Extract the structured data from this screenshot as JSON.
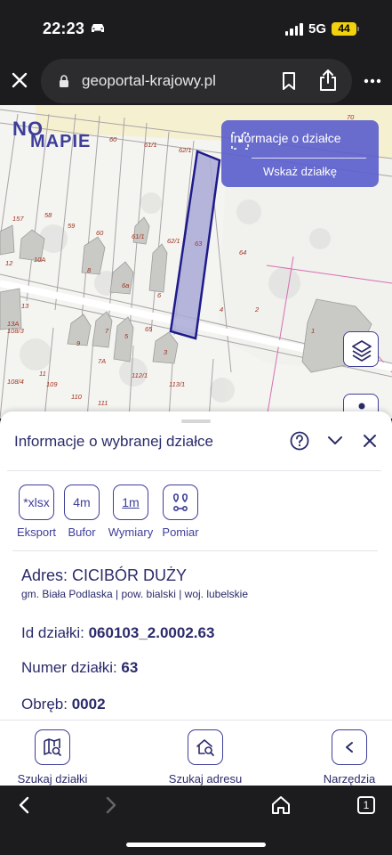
{
  "status_bar": {
    "time": "22:23",
    "network": "5G",
    "battery": "44"
  },
  "browser": {
    "url": "geoportal-krajowy.pl",
    "tab_count": "1"
  },
  "map": {
    "logo_no": "NO",
    "logo_mapie": "MAPIE",
    "info_card": {
      "title": "Informacje o działce",
      "action": "Wskaż działkę"
    },
    "labels": [
      "70",
      "60",
      "61/1",
      "62/1",
      "58",
      "59",
      "60",
      "157",
      "10A",
      "12",
      "61/1",
      "62/1",
      "63",
      "64",
      "8",
      "6a",
      "6",
      "4",
      "2",
      "13",
      "13A",
      "108/3",
      "9",
      "7",
      "65",
      "5",
      "3",
      "7A",
      "1",
      "11",
      "109",
      "110",
      "112/1",
      "113/1",
      "108/4",
      "111"
    ]
  },
  "sheet": {
    "title": "Informacje o wybranej działce",
    "tools": [
      {
        "icon": "*xlsx",
        "label": "Eksport"
      },
      {
        "icon": "4m",
        "label": "Bufor"
      },
      {
        "icon": "1m",
        "label": "Wymiary"
      },
      {
        "icon": "",
        "label": "Pomiar"
      }
    ],
    "address_label": "Adres: CICIBÓR DUŻY",
    "address_sub": "gm. Biała Podlaska | pow. bialski | woj. lubelskie",
    "fields": [
      {
        "label": "Id działki: ",
        "value": "060103_2.0002.63"
      },
      {
        "label": "Numer działki: ",
        "value": "63"
      },
      {
        "label": "Obręb: ",
        "value": "0002"
      }
    ]
  },
  "bottom_nav": [
    {
      "label": "Szukaj działki"
    },
    {
      "label": "Szukaj adresu"
    },
    {
      "label": "Narzędzia"
    }
  ],
  "colors": {
    "accent": "#3e3e9a",
    "parcel_fill": "#a9a9d8",
    "card": "#5c60cc"
  }
}
